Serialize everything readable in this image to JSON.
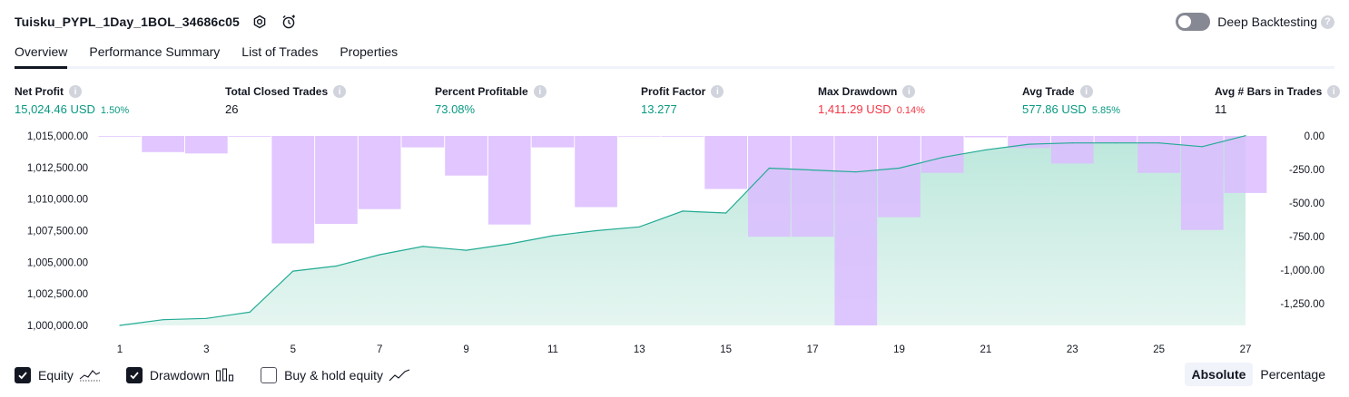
{
  "header": {
    "title": "Tuisku_PYPL_1Day_1BOL_34686c05",
    "deep_backtesting_label": "Deep Backtesting",
    "help_symbol": "?"
  },
  "tabs": [
    {
      "label": "Overview",
      "active": true
    },
    {
      "label": "Performance Summary",
      "active": false
    },
    {
      "label": "List of Trades",
      "active": false
    },
    {
      "label": "Properties",
      "active": false
    }
  ],
  "metrics": {
    "info_symbol": "i",
    "net_profit": {
      "label": "Net Profit",
      "value": "15,024.46 USD",
      "pct": "1.50%"
    },
    "total_closed_trades": {
      "label": "Total Closed Trades",
      "value": "26"
    },
    "percent_profitable": {
      "label": "Percent Profitable",
      "value": "73.08%"
    },
    "profit_factor": {
      "label": "Profit Factor",
      "value": "13.277"
    },
    "max_drawdown": {
      "label": "Max Drawdown",
      "value": "1,411.29 USD",
      "pct": "0.14%"
    },
    "avg_trade": {
      "label": "Avg Trade",
      "value": "577.86 USD",
      "pct": "5.85%"
    },
    "avg_bars": {
      "label": "Avg # Bars in Trades",
      "value": "11"
    }
  },
  "colors": {
    "positive": "#089981",
    "negative": "#f23645",
    "equity_line": "#22ab94",
    "equity_fill": "#c8ebe2",
    "drawdown_bar": "#dcbcff"
  },
  "chart_data": {
    "type": "area",
    "equity_axis": {
      "ticks": [
        "1,015,000.00",
        "1,012,500.00",
        "1,010,000.00",
        "1,007,500.00",
        "1,005,000.00",
        "1,002,500.00",
        "1,000,000.00"
      ],
      "range": [
        1000000,
        1015000
      ]
    },
    "drawdown_axis": {
      "ticks": [
        "0.00",
        "-250.00",
        "-500.00",
        "-750.00",
        "-1,000.00",
        "-1,250.00"
      ],
      "range": [
        -1411.29,
        0
      ]
    },
    "x_ticks": [
      "1",
      "3",
      "5",
      "7",
      "9",
      "11",
      "13",
      "15",
      "17",
      "19",
      "21",
      "23",
      "25",
      "27"
    ],
    "x_range": [
      1,
      27
    ],
    "series": [
      {
        "name": "Equity",
        "type": "line",
        "x": [
          1,
          2,
          3,
          4,
          5,
          6,
          7,
          8,
          9,
          10,
          11,
          12,
          13,
          14,
          15,
          16,
          17,
          18,
          19,
          20,
          21,
          22,
          23,
          24,
          25,
          26,
          27
        ],
        "values": [
          1000000,
          1000450,
          1000550,
          1001050,
          1004300,
          1004700,
          1005600,
          1006250,
          1005950,
          1006450,
          1007100,
          1007500,
          1007800,
          1009050,
          1008900,
          1012450,
          1012300,
          1012150,
          1012450,
          1013300,
          1013900,
          1014350,
          1014450,
          1014450,
          1014450,
          1014150,
          1015024
        ]
      },
      {
        "name": "Drawdown",
        "type": "bar",
        "x": [
          1,
          2,
          3,
          4,
          5,
          6,
          7,
          8,
          9,
          10,
          11,
          12,
          13,
          14,
          15,
          16,
          17,
          18,
          19,
          20,
          21,
          22,
          23,
          24,
          25,
          26,
          27
        ],
        "values": [
          0,
          -120,
          -130,
          0,
          -800,
          -655,
          -545,
          -85,
          -295,
          -660,
          -85,
          -530,
          -5,
          0,
          -395,
          -750,
          -750,
          -1411.29,
          -605,
          -275,
          -10,
          -90,
          -205,
          -50,
          -275,
          -700,
          -425
        ]
      }
    ]
  },
  "legend": {
    "equity": {
      "label": "Equity",
      "checked": true
    },
    "drawdown": {
      "label": "Drawdown",
      "checked": true
    },
    "buy_hold": {
      "label": "Buy & hold equity",
      "checked": false
    }
  },
  "mode": {
    "absolute": "Absolute",
    "percentage": "Percentage"
  }
}
